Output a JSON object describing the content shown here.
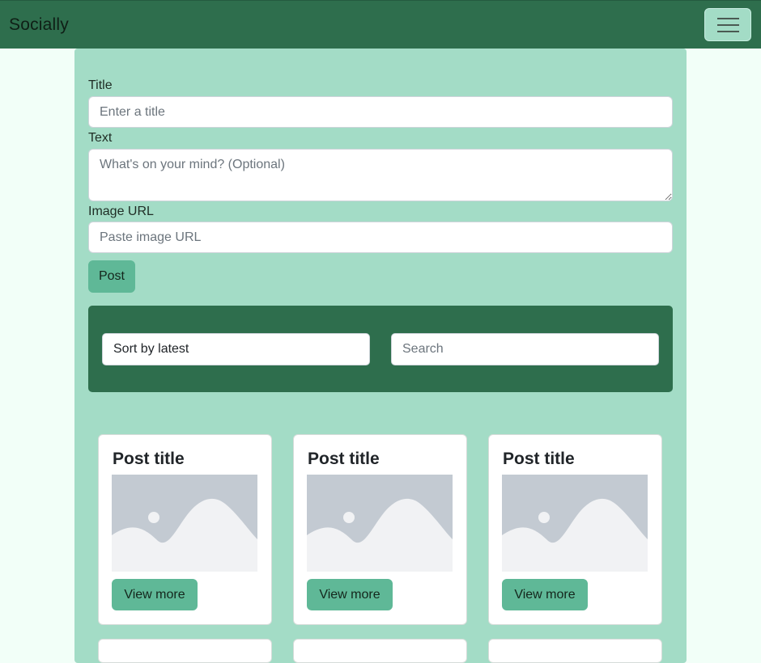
{
  "navbar": {
    "brand": "Socially",
    "menu_icon": "hamburger-menu-icon"
  },
  "form": {
    "title_label": "Title",
    "title_placeholder": "Enter a title",
    "text_label": "Text",
    "text_placeholder": "What's on your mind? (Optional)",
    "image_label": "Image URL",
    "image_placeholder": "Paste image URL",
    "post_button": "Post"
  },
  "filters": {
    "sort_value": "Sort by latest",
    "search_placeholder": "Search"
  },
  "cards": [
    {
      "title": "Post title",
      "button": "View more",
      "image_icon": "placeholder-image-icon"
    },
    {
      "title": "Post title",
      "button": "View more",
      "image_icon": "placeholder-image-icon"
    },
    {
      "title": "Post title",
      "button": "View more",
      "image_icon": "placeholder-image-icon"
    }
  ],
  "colors": {
    "navbar": "#2e6e4d",
    "panel": "#a3dcc6",
    "button": "#5fb897",
    "page_background": "#f2fff8"
  }
}
